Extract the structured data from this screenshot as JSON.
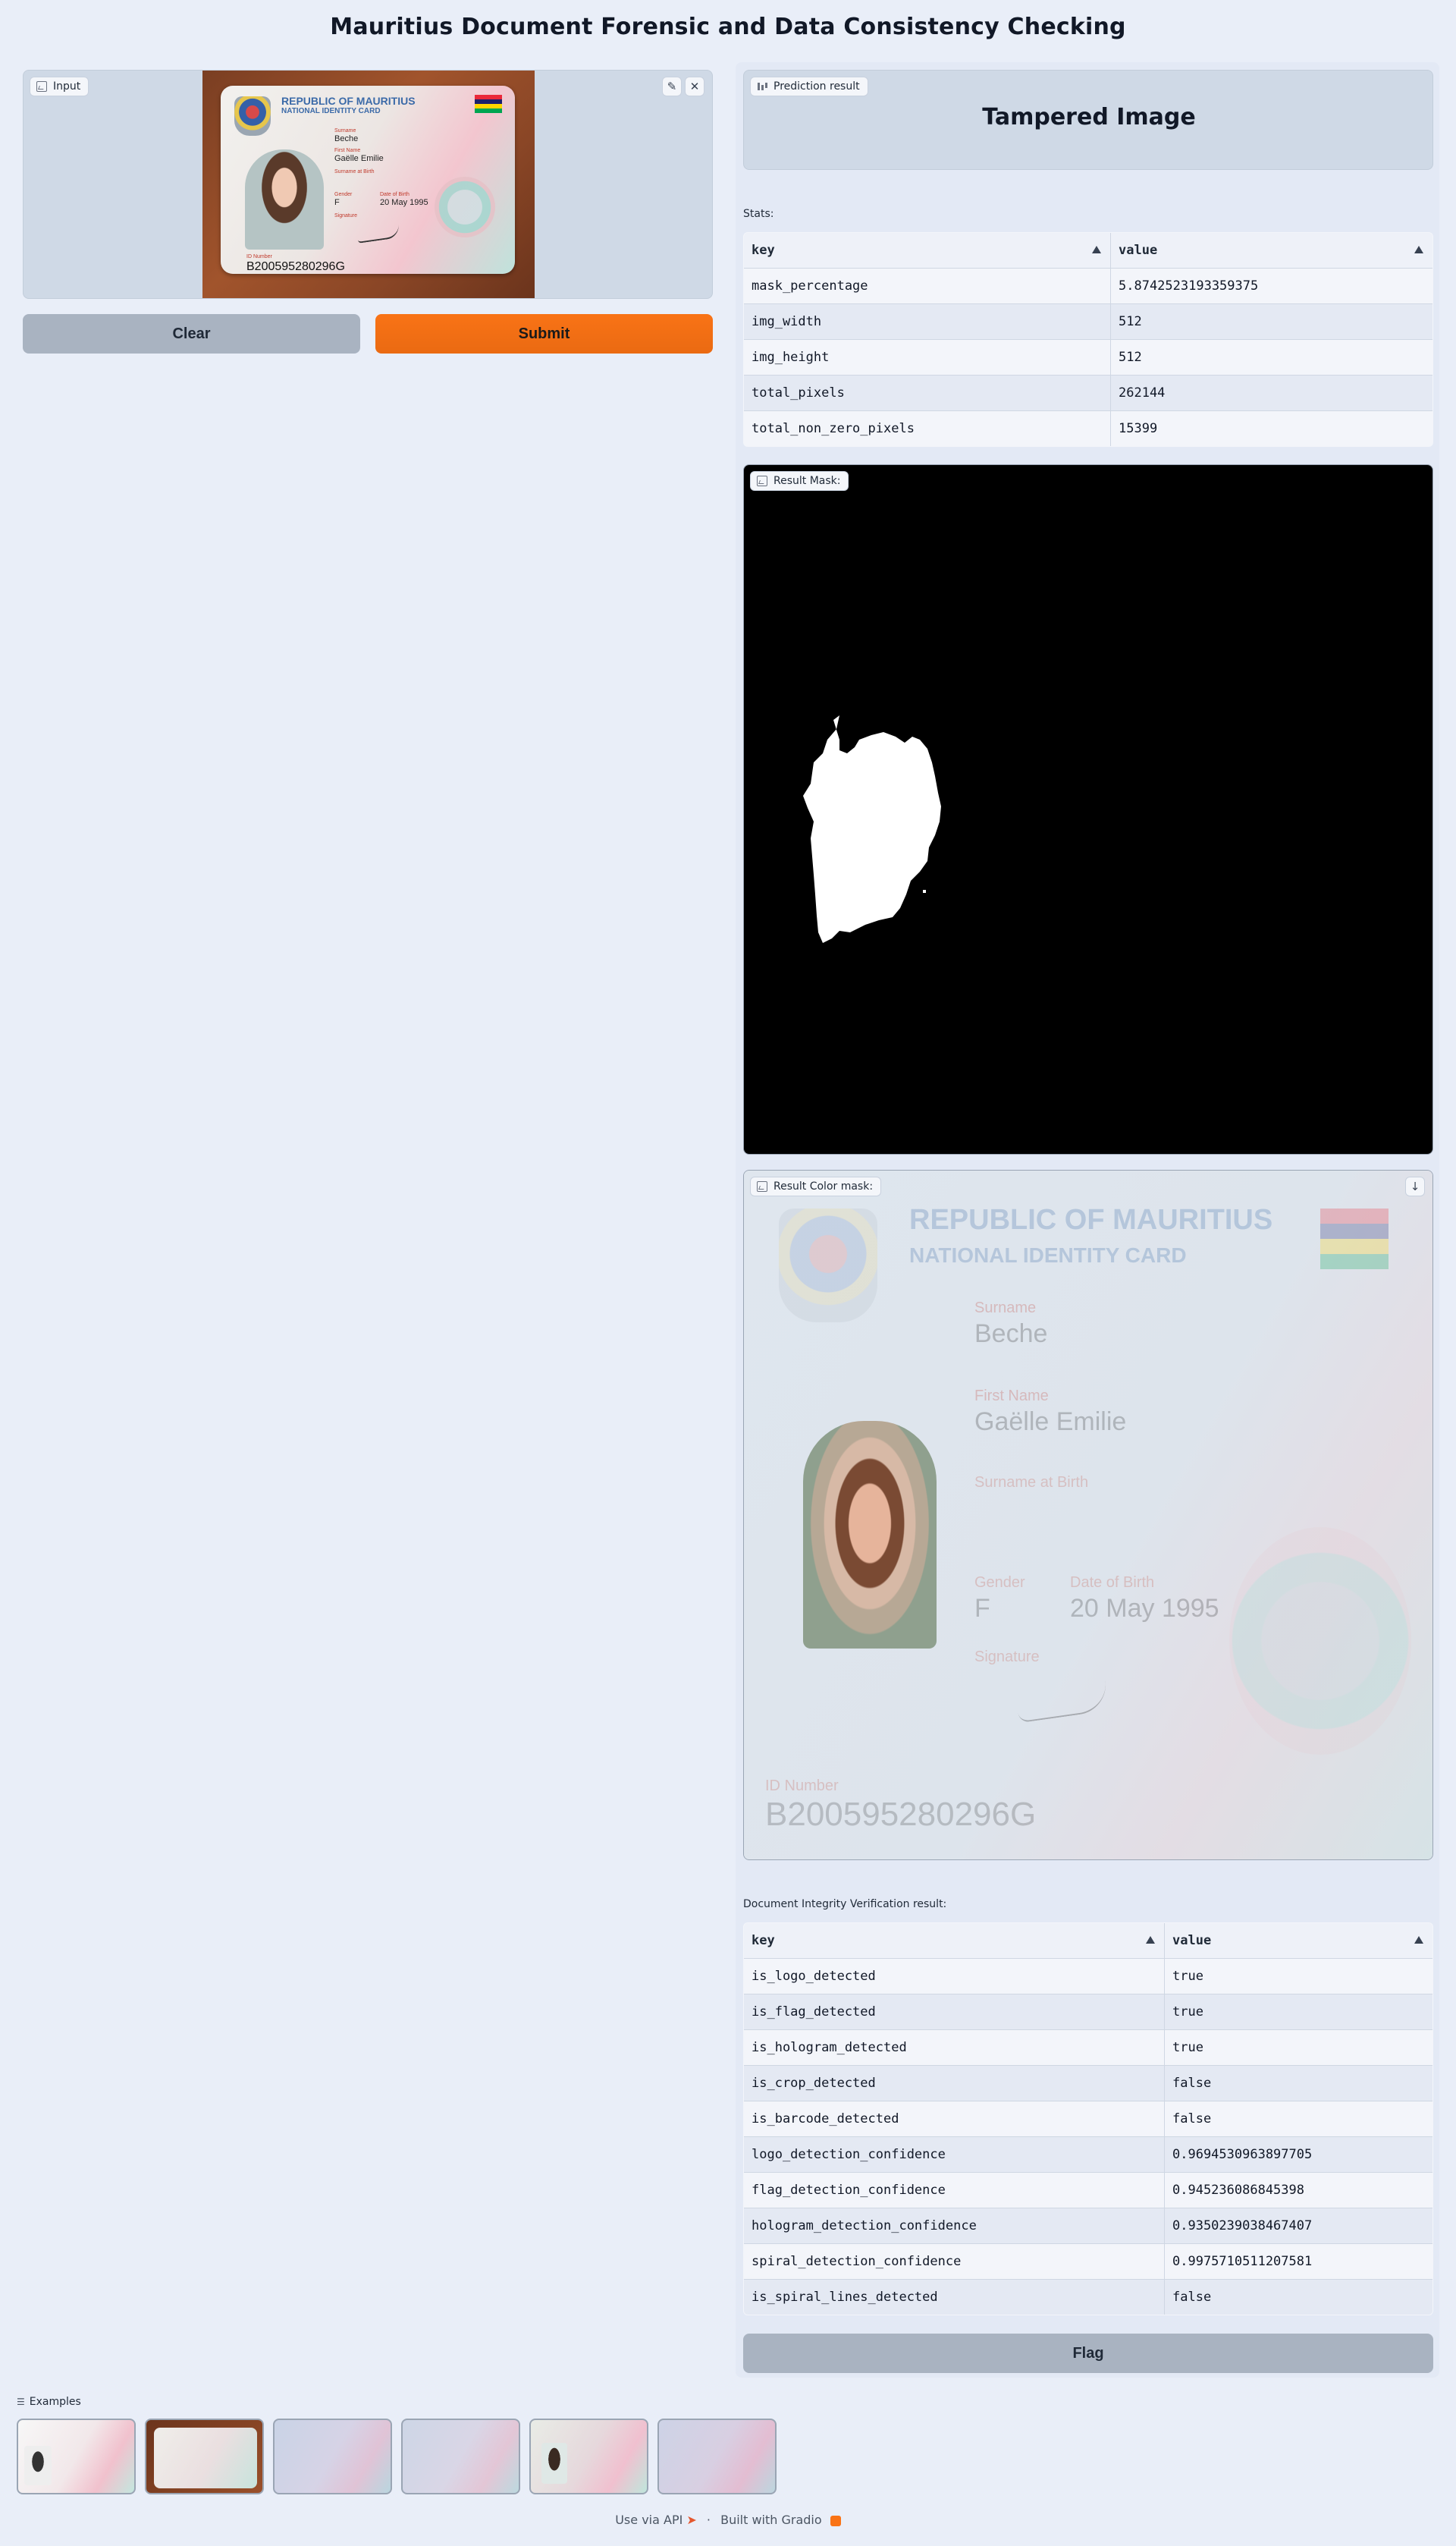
{
  "app": {
    "title": "Mauritius Document Forensic and Data Consistency Checking"
  },
  "input_panel": {
    "label": "Input",
    "card": {
      "country": "REPUBLIC OF MAURITIUS",
      "card_type": "NATIONAL IDENTITY CARD",
      "surname_label": "Surname",
      "surname": "Beche",
      "first_name_label": "First Name",
      "first_name": "Gaëlle Emilie",
      "surname_birth_label": "Surname at Birth",
      "gender_label": "Gender",
      "gender": "F",
      "dob_label": "Date of Birth",
      "dob": "20 May 1995",
      "signature_label": "Signature",
      "id_label": "ID Number",
      "id_number": "B200595280296G"
    }
  },
  "buttons": {
    "clear": "Clear",
    "submit": "Submit",
    "flag": "Flag"
  },
  "prediction": {
    "label": "Prediction result",
    "value": "Tampered Image"
  },
  "stats": {
    "label": "Stats:",
    "headers": [
      "key",
      "value"
    ],
    "rows": [
      [
        "mask_percentage",
        "5.8742523193359375"
      ],
      [
        "img_width",
        "512"
      ],
      [
        "img_height",
        "512"
      ],
      [
        "total_pixels",
        "262144"
      ],
      [
        "total_non_zero_pixels",
        "15399"
      ]
    ]
  },
  "result_mask": {
    "label": "Result Mask:"
  },
  "result_color_mask": {
    "label": "Result Color mask:"
  },
  "verification": {
    "label": "Document Integrity Verification result:",
    "headers": [
      "key",
      "value"
    ],
    "rows": [
      [
        "is_logo_detected",
        "true"
      ],
      [
        "is_flag_detected",
        "true"
      ],
      [
        "is_hologram_detected",
        "true"
      ],
      [
        "is_crop_detected",
        "false"
      ],
      [
        "is_barcode_detected",
        "false"
      ],
      [
        "logo_detection_confidence",
        "0.9694530963897705"
      ],
      [
        "flag_detection_confidence",
        "0.945236086845398"
      ],
      [
        "hologram_detection_confidence",
        "0.9350239038467407"
      ],
      [
        "spiral_detection_confidence",
        "0.9975710511207581"
      ],
      [
        "is_spiral_lines_detected",
        "false"
      ]
    ]
  },
  "examples": {
    "label": "Examples"
  },
  "footer": {
    "api": "Use via API",
    "built": "Built with Gradio"
  },
  "icons": {
    "image": "image-icon",
    "edit": "pencil-icon",
    "close": "close-icon",
    "download": "download-icon",
    "chart": "bar-chart-icon",
    "list": "list-icon",
    "rocket": "rocket-icon",
    "gradio": "gradio-logo-icon"
  },
  "colors": {
    "accent": "#f97316",
    "background": "#e9eef8",
    "panel": "#cfd9e6"
  }
}
